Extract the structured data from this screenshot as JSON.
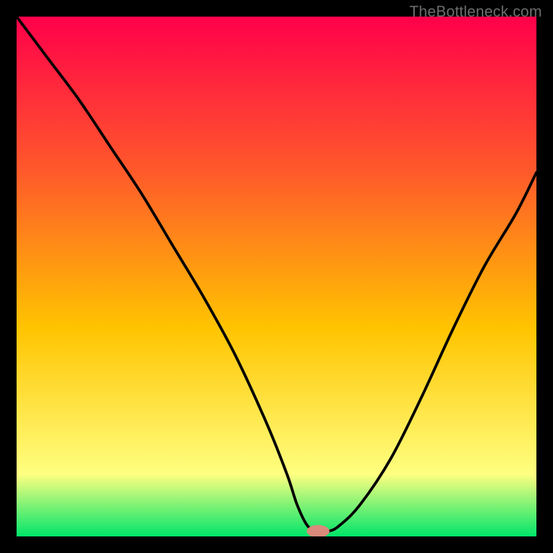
{
  "watermark": "TheBottleneck.com",
  "colors": {
    "background": "#000000",
    "watermark_text": "#6d6d6d",
    "gradient_top": "#ff004a",
    "gradient_mid1": "#ff5a2a",
    "gradient_mid2": "#ffc400",
    "gradient_mid3": "#ffff80",
    "gradient_bottom": "#00e56a",
    "curve": "#000000",
    "marker_fill": "#d98a7a"
  },
  "chart_data": {
    "type": "line",
    "title": "",
    "xlabel": "",
    "ylabel": "",
    "xlim": [
      0,
      100
    ],
    "ylim": [
      0,
      100
    ],
    "grid": false,
    "legend": false,
    "annotations": [],
    "series": [
      {
        "name": "bottleneck-curve",
        "x": [
          0,
          6,
          12,
          18,
          24,
          30,
          36,
          42,
          48,
          52,
          54,
          56,
          58,
          60,
          62,
          66,
          72,
          78,
          84,
          90,
          96,
          100
        ],
        "y": [
          100,
          92,
          84,
          75,
          66,
          56,
          46,
          35,
          22,
          12,
          6,
          2,
          1,
          1,
          2,
          6,
          15,
          27,
          40,
          52,
          62,
          70
        ]
      }
    ],
    "marker": {
      "x": 58,
      "y": 1,
      "rx": 2.2,
      "ry": 1.2
    }
  }
}
